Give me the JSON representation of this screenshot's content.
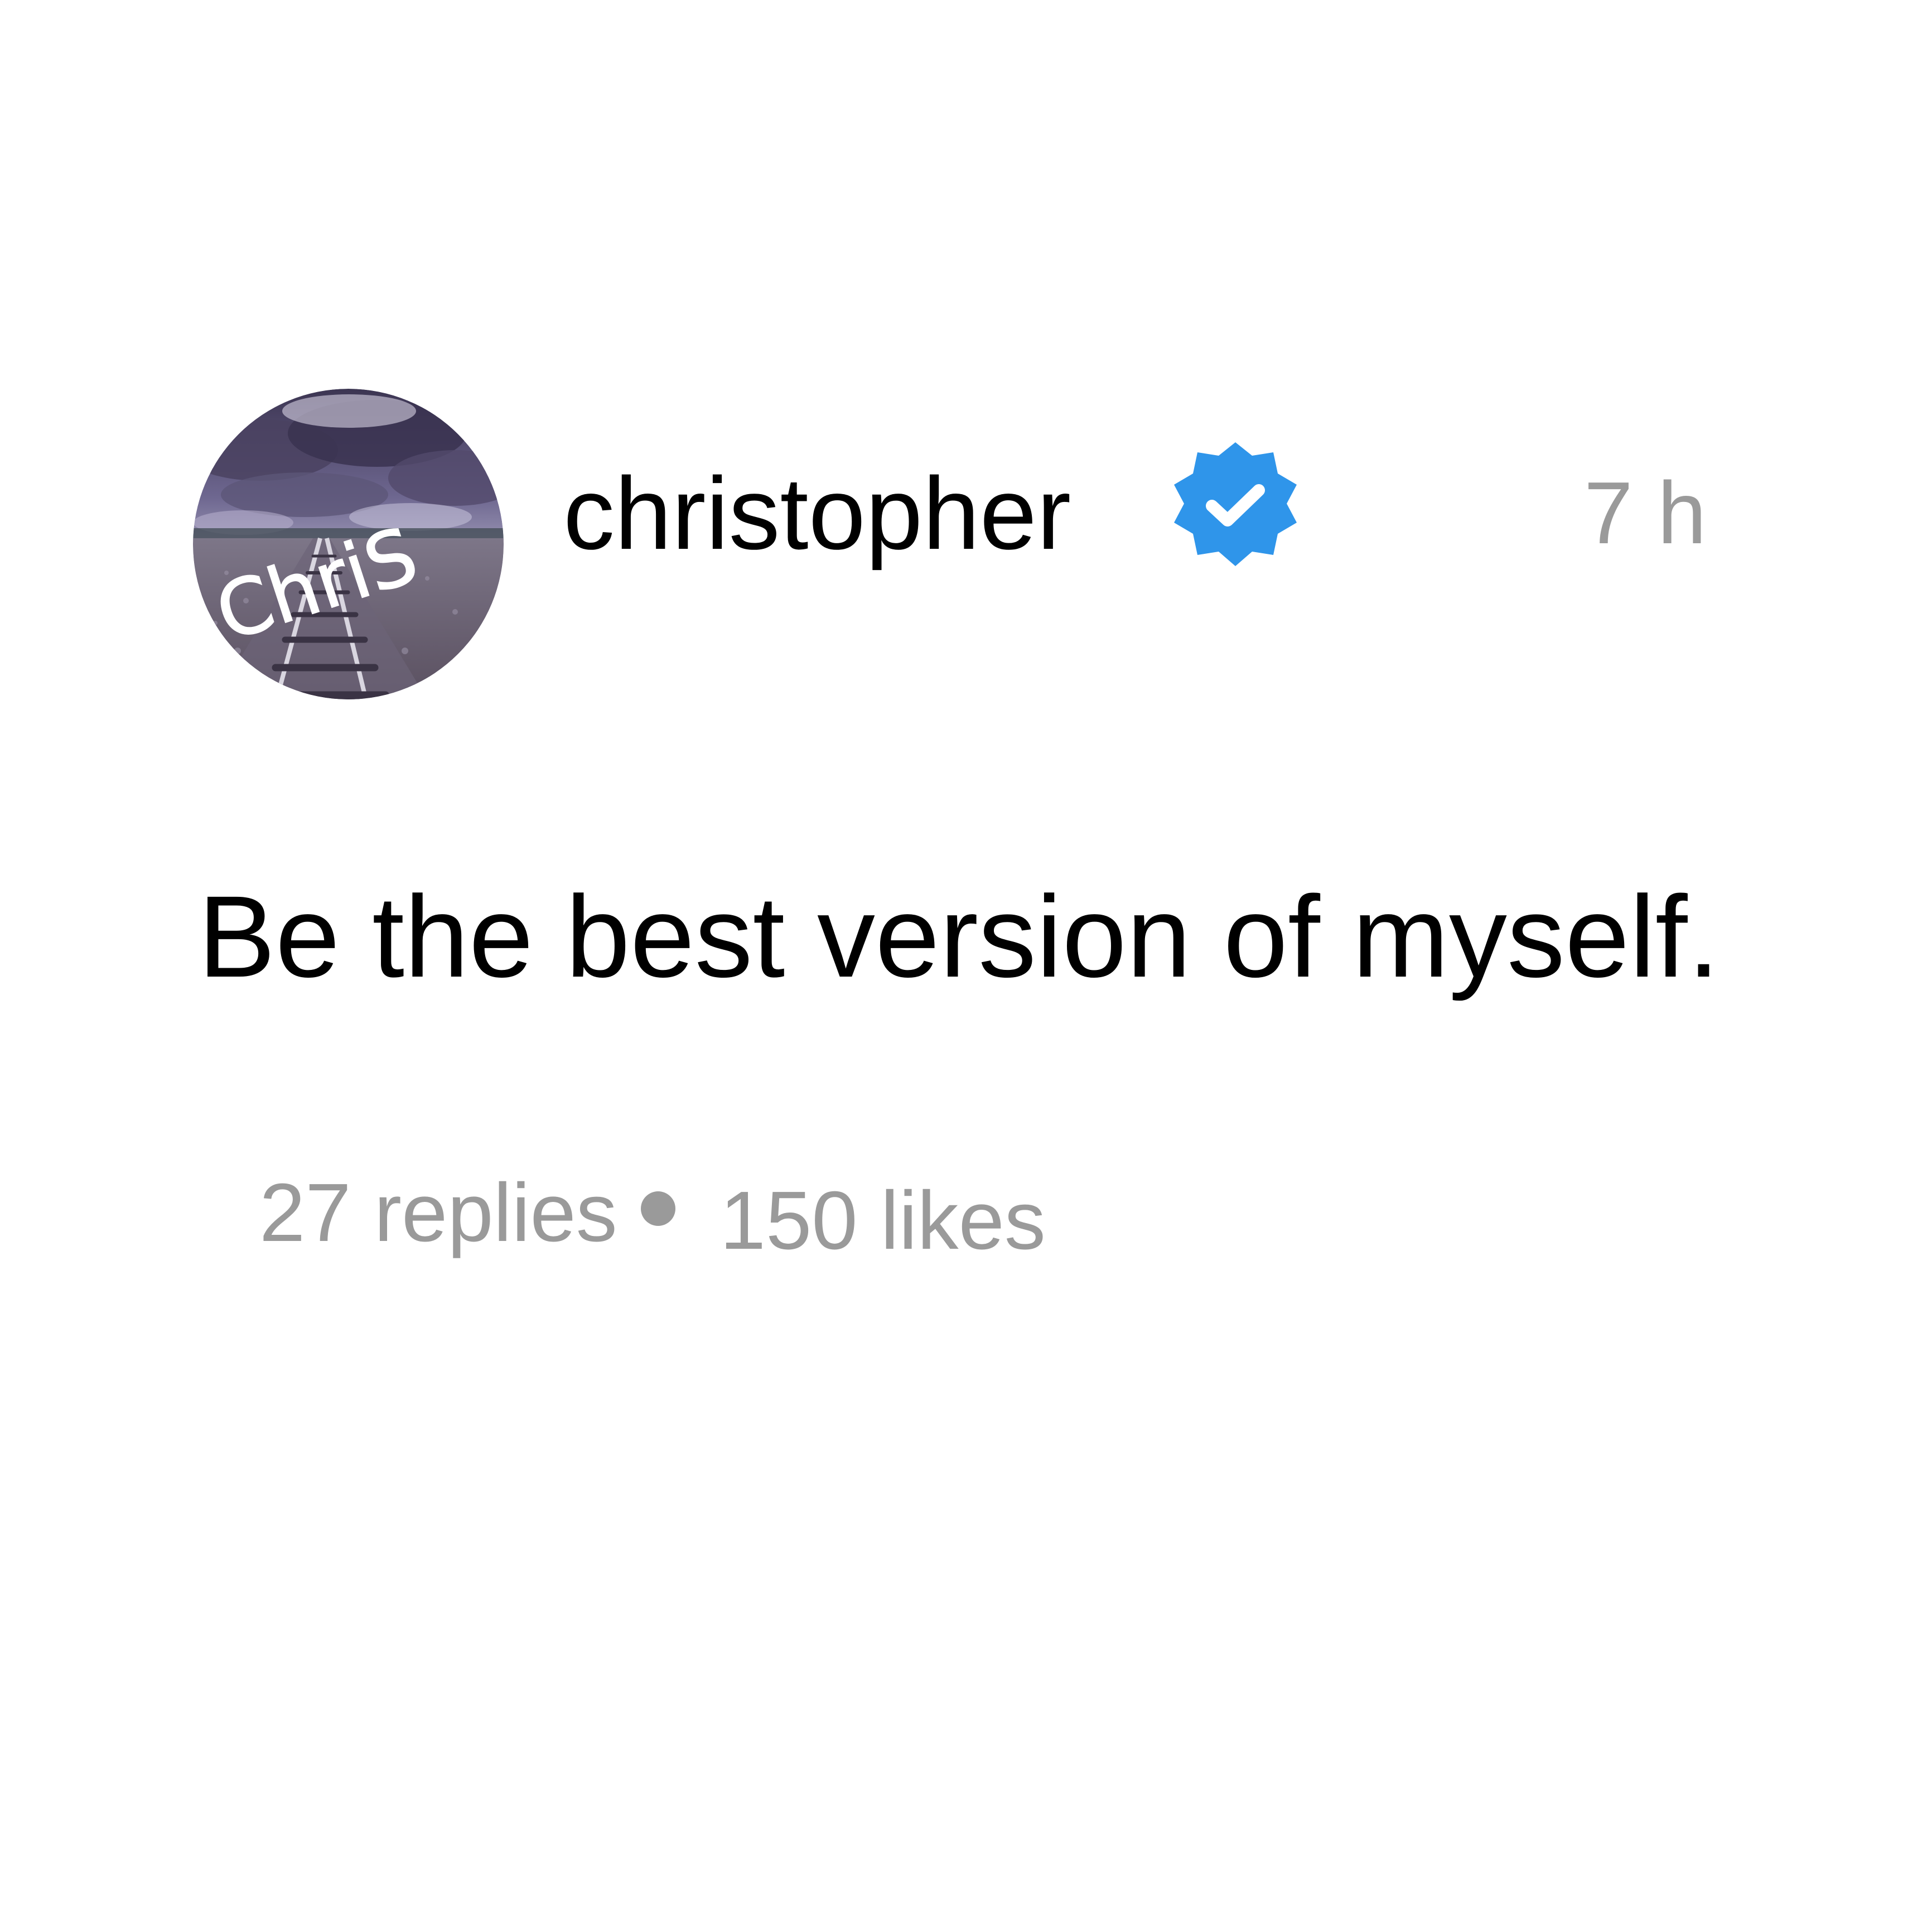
{
  "post": {
    "avatar_text": "ChriS",
    "username": "christopher",
    "verified_icon": "verified-badge-icon",
    "time": "7 h",
    "text": "Be the best version of myself.",
    "replies": "27 replies",
    "likes": "150 likes"
  },
  "colors": {
    "text": "#000000",
    "muted": "#9a9a9a",
    "verified": "#2f95ea",
    "background": "#ffffff"
  }
}
